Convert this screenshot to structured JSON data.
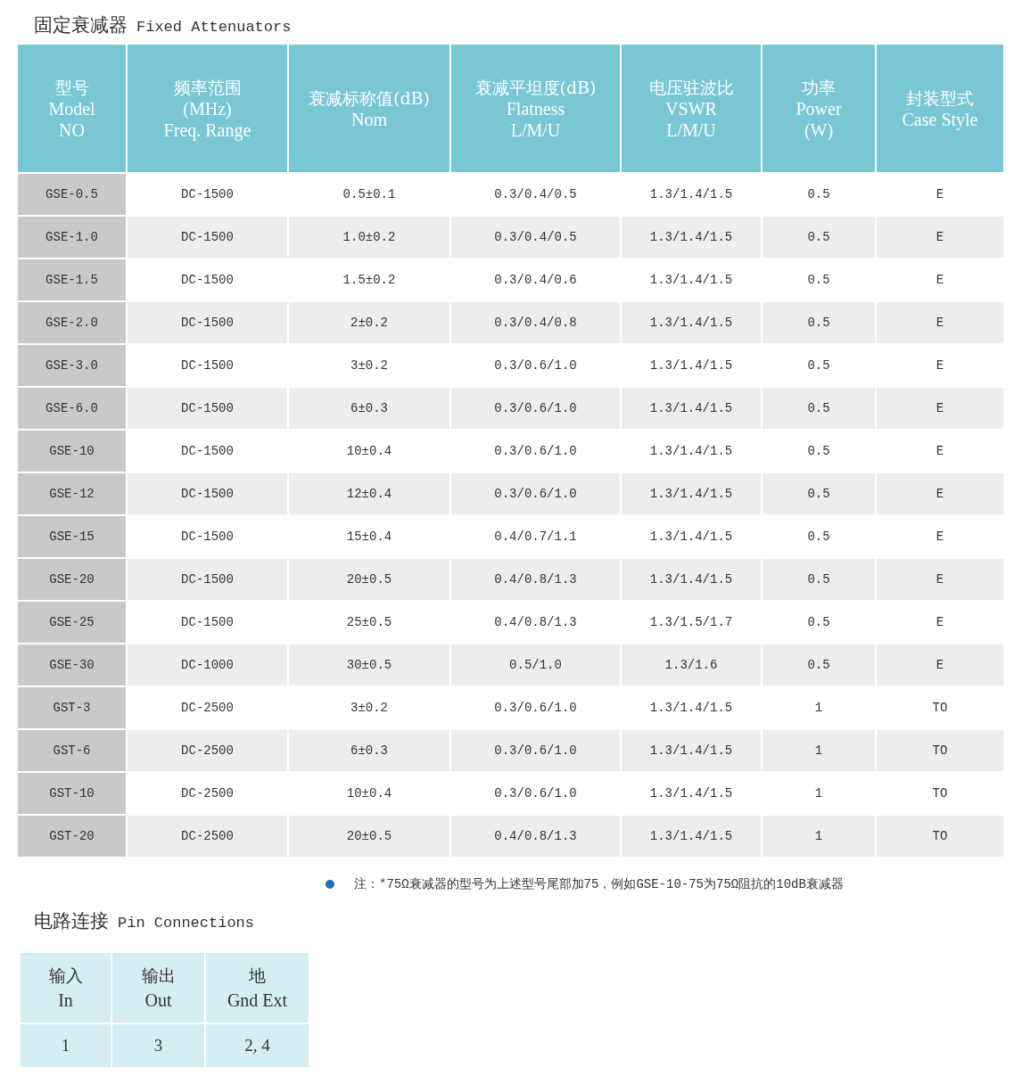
{
  "title": {
    "zh": "固定衰减器",
    "en": "Fixed Attenuators"
  },
  "table": {
    "columns": [
      {
        "lines": [
          "型号",
          "Model",
          "NO"
        ]
      },
      {
        "lines": [
          "频率范围",
          "(MHz)",
          "Freq. Range"
        ]
      },
      {
        "lines": [
          "衰减标称值(dB)",
          "Nom"
        ]
      },
      {
        "lines": [
          "衰减平坦度(dB)",
          "Flatness",
          "L/M/U"
        ]
      },
      {
        "lines": [
          "电压驻波比",
          "VSWR",
          "L/M/U"
        ]
      },
      {
        "lines": [
          "功率",
          "Power",
          "(W)"
        ]
      },
      {
        "lines": [
          "封装型式",
          "Case Style"
        ]
      }
    ],
    "rows": [
      [
        "GSE-0.5",
        "DC-1500",
        "0.5±0.1",
        "0.3/0.4/0.5",
        "1.3/1.4/1.5",
        "0.5",
        "E"
      ],
      [
        "GSE-1.0",
        "DC-1500",
        "1.0±0.2",
        "0.3/0.4/0.5",
        "1.3/1.4/1.5",
        "0.5",
        "E"
      ],
      [
        "GSE-1.5",
        "DC-1500",
        "1.5±0.2",
        "0.3/0.4/0.6",
        "1.3/1.4/1.5",
        "0.5",
        "E"
      ],
      [
        "GSE-2.0",
        "DC-1500",
        "2±0.2",
        "0.3/0.4/0.8",
        "1.3/1.4/1.5",
        "0.5",
        "E"
      ],
      [
        "GSE-3.0",
        "DC-1500",
        "3±0.2",
        "0.3/0.6/1.0",
        "1.3/1.4/1.5",
        "0.5",
        "E"
      ],
      [
        "GSE-6.0",
        "DC-1500",
        "6±0.3",
        "0.3/0.6/1.0",
        "1.3/1.4/1.5",
        "0.5",
        "E"
      ],
      [
        "GSE-10",
        "DC-1500",
        "10±0.4",
        "0.3/0.6/1.0",
        "1.3/1.4/1.5",
        "0.5",
        "E"
      ],
      [
        "GSE-12",
        "DC-1500",
        "12±0.4",
        "0.3/0.6/1.0",
        "1.3/1.4/1.5",
        "0.5",
        "E"
      ],
      [
        "GSE-15",
        "DC-1500",
        "15±0.4",
        "0.4/0.7/1.1",
        "1.3/1.4/1.5",
        "0.5",
        "E"
      ],
      [
        "GSE-20",
        "DC-1500",
        "20±0.5",
        "0.4/0.8/1.3",
        "1.3/1.4/1.5",
        "0.5",
        "E"
      ],
      [
        "GSE-25",
        "DC-1500",
        "25±0.5",
        "0.4/0.8/1.3",
        "1.3/1.5/1.7",
        "0.5",
        "E"
      ],
      [
        "GSE-30",
        "DC-1000",
        "30±0.5",
        "0.5/1.0",
        "1.3/1.6",
        "0.5",
        "E"
      ],
      [
        "GST-3",
        "DC-2500",
        "3±0.2",
        "0.3/0.6/1.0",
        "1.3/1.4/1.5",
        "1",
        "TO"
      ],
      [
        "GST-6",
        "DC-2500",
        "6±0.3",
        "0.3/0.6/1.0",
        "1.3/1.4/1.5",
        "1",
        "TO"
      ],
      [
        "GST-10",
        "DC-2500",
        "10±0.4",
        "0.3/0.6/1.0",
        "1.3/1.4/1.5",
        "1",
        "TO"
      ],
      [
        "GST-20",
        "DC-2500",
        "20±0.5",
        "0.4/0.8/1.3",
        "1.3/1.4/1.5",
        "1",
        "TO"
      ]
    ]
  },
  "note": "注：*75Ω衰减器的型号为上述型号尾部加75，例如GSE-10-75为75Ω阻抗的10dB衰减器",
  "pin_title": {
    "zh": "电路连接",
    "en": "Pin Connections"
  },
  "pins": {
    "columns": [
      {
        "lines": [
          "输入",
          "In"
        ]
      },
      {
        "lines": [
          "输出",
          "Out"
        ]
      },
      {
        "lines": [
          "地",
          "Gnd Ext"
        ]
      }
    ],
    "values": [
      "1",
      "3",
      "2, 4"
    ]
  }
}
